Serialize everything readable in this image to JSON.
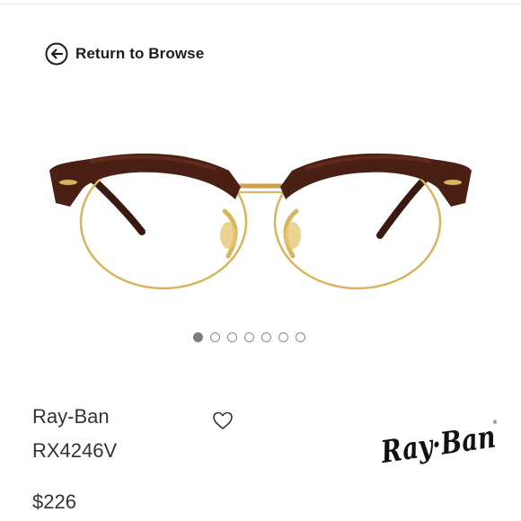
{
  "nav": {
    "back_label": "Return to Browse",
    "back_icon": "arrow-left-circle-icon"
  },
  "gallery": {
    "image_count": 7,
    "active_index": 0
  },
  "product": {
    "brand": "Ray-Ban",
    "model": "RX4246V",
    "price": "$226",
    "favorite_icon": "heart-outline-icon",
    "logo_text": "Ray-Ban"
  },
  "colors": {
    "frame_tortoise": "#4a1f14",
    "frame_gold": "#d8b45c",
    "text": "#333333",
    "dot_active": "#7d7d7d"
  }
}
